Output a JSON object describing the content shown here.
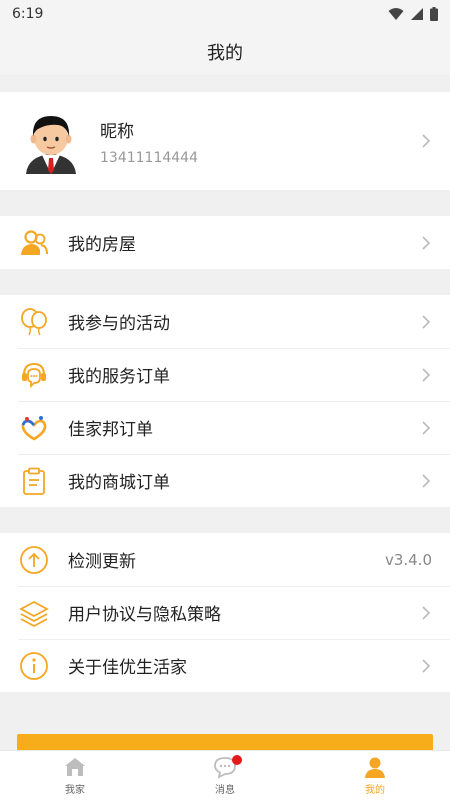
{
  "status_bar": {
    "time": "6:19"
  },
  "header": {
    "title": "我的"
  },
  "profile": {
    "nickname": "昵称",
    "phone": "13411114444"
  },
  "section_house": [
    {
      "icon": "house-people-icon",
      "label": "我的房屋"
    }
  ],
  "section_orders": [
    {
      "icon": "balloon-icon",
      "label": "我参与的活动"
    },
    {
      "icon": "service-headset-icon",
      "label": "我的服务订单"
    },
    {
      "icon": "jiajiabang-logo-icon",
      "label": "佳家邦订单"
    },
    {
      "icon": "clipboard-icon",
      "label": "我的商城订单"
    }
  ],
  "section_settings": [
    {
      "icon": "upload-arrow-icon",
      "label": "检测更新",
      "value": "v3.4.0"
    },
    {
      "icon": "layers-icon",
      "label": "用户协议与隐私策略"
    },
    {
      "icon": "info-icon",
      "label": "关于佳优生活家"
    }
  ],
  "tabs": [
    {
      "icon": "home-icon",
      "label": "我家",
      "active": false
    },
    {
      "icon": "chat-bubble-icon",
      "label": "消息",
      "active": false,
      "has_badge": true
    },
    {
      "icon": "person-icon",
      "label": "我的",
      "active": true
    }
  ],
  "colors": {
    "accent": "#f5a623",
    "badge": "#e21a1a",
    "background": "#f0f0f0"
  }
}
